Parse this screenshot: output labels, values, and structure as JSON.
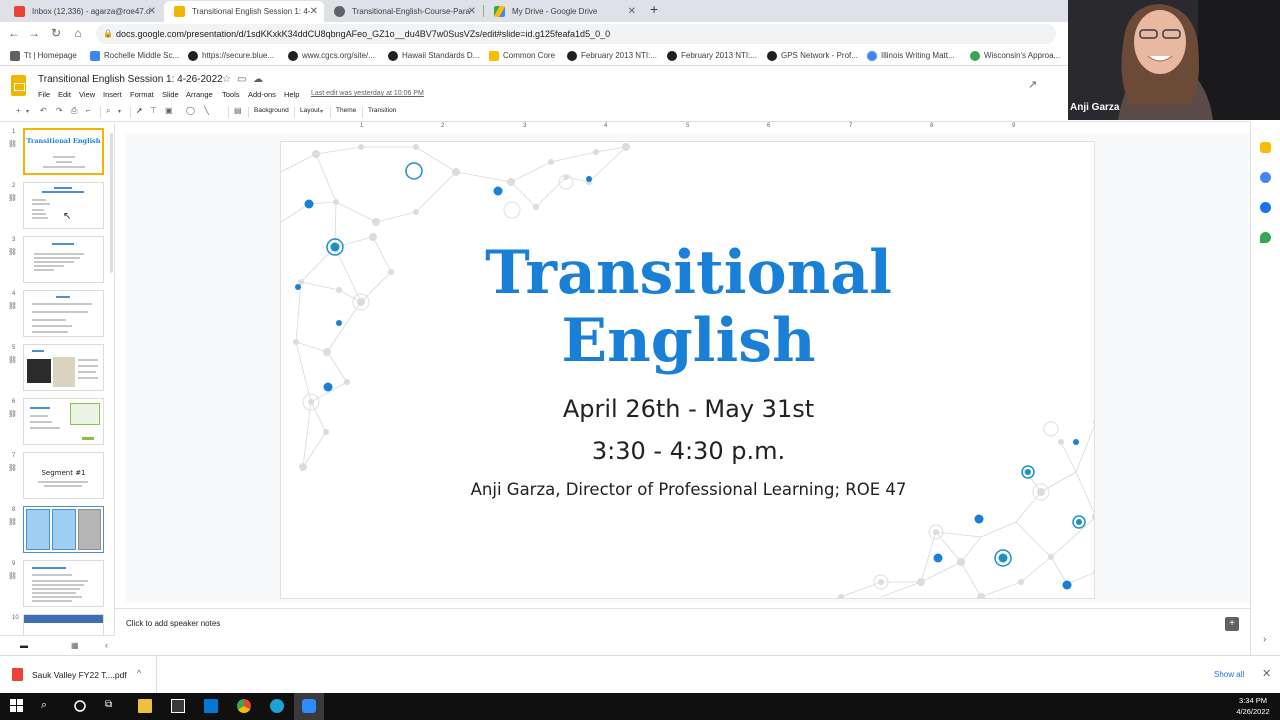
{
  "browser": {
    "tabs": [
      {
        "label": "Inbox (12,336) - agarza@roe47.o",
        "color": "#ea4335",
        "active": false
      },
      {
        "label": "Transitional English Session 1: 4-",
        "color": "#f4b400",
        "active": true
      },
      {
        "label": "Transitional-English-Course-Para",
        "color": "#5f6368",
        "active": false
      },
      {
        "label": "My Drive - Google Drive",
        "color": "#34a853",
        "active": false
      }
    ],
    "url": "docs.google.com/presentation/d/1sdKKxkK34ddCU8qbngAFeo_GZ1o__du4BV7w0SusVZs/edit#slide=id.g125feafa1d5_0_0",
    "bookmarks": [
      "Tt | Homepage",
      "Rochelle Middle Sc...",
      "https://secure.blue...",
      "www.cgcs.org/site/...",
      "Hawaii Standards D...",
      "Common Core",
      "February 2013 NTI:...",
      "February 2013 NTI:...",
      "GPS Network - Prof...",
      "Illinois Writing Matt...",
      "Wisconsin's Approa..."
    ]
  },
  "slides_app": {
    "doc_title": "Transitional English Session 1: 4-26-2022",
    "menus": [
      "File",
      "Edit",
      "View",
      "Insert",
      "Format",
      "Slide",
      "Arrange",
      "Tools",
      "Add-ons",
      "Help"
    ],
    "last_edit": "Last edit was yesterday at 10:06 PM",
    "toolbar": {
      "background": "Background",
      "layout": "Layout",
      "theme": "Theme",
      "transition": "Transition"
    },
    "ruler_ticks": [
      "1",
      "2",
      "3",
      "4",
      "5",
      "6",
      "7",
      "8",
      "9"
    ],
    "thumbnail_numbers": [
      "1",
      "2",
      "3",
      "4",
      "5",
      "6",
      "7",
      "8",
      "9",
      "10"
    ],
    "thumb1": {
      "title": "Transitional English"
    },
    "thumb7": {
      "title": "Segment #1"
    },
    "slide": {
      "title_line1": "Transitional",
      "title_line2": "English",
      "dates": "April 26th - May 31st",
      "time": "3:30 - 4:30 p.m.",
      "author": "Anji Garza, Director of Professional Learning; ROE 47",
      "title_color": "#1a7fd6"
    },
    "speaker_notes_placeholder": "Click to add speaker notes"
  },
  "video": {
    "person_name": "Anji Garza"
  },
  "downloads": {
    "file_name": "Sauk Valley FY22 T....pdf",
    "show_all": "Show all"
  },
  "taskbar": {
    "time": "3:34 PM",
    "date": "4/26/2022"
  }
}
